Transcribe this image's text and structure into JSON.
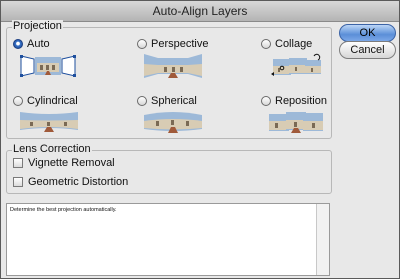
{
  "window": {
    "title": "Auto-Align Layers"
  },
  "projection": {
    "legend": "Projection",
    "options": [
      {
        "label": "Auto",
        "selected": true
      },
      {
        "label": "Perspective",
        "selected": false
      },
      {
        "label": "Collage",
        "selected": false
      },
      {
        "label": "Cylindrical",
        "selected": false
      },
      {
        "label": "Spherical",
        "selected": false
      },
      {
        "label": "Reposition",
        "selected": false
      }
    ]
  },
  "lens_correction": {
    "legend": "Lens Correction",
    "options": [
      {
        "label": "Vignette Removal",
        "checked": false
      },
      {
        "label": "Geometric Distortion",
        "checked": false
      }
    ]
  },
  "buttons": {
    "ok": "OK",
    "cancel": "Cancel"
  },
  "description": "Determine the best projection automatically.",
  "colors": {
    "accent": "#3a73c9",
    "dialog_bg": "#e8e8e8",
    "sky": "#9db9d8",
    "building": "#d8ccb4",
    "path": "#a05a3a"
  },
  "icons": {
    "auto_thumb": "auto-projection-icon",
    "perspective_thumb": "perspective-projection-icon",
    "collage_thumb": "collage-projection-icon",
    "cylindrical_thumb": "cylindrical-projection-icon",
    "spherical_thumb": "spherical-projection-icon",
    "reposition_thumb": "reposition-projection-icon"
  }
}
